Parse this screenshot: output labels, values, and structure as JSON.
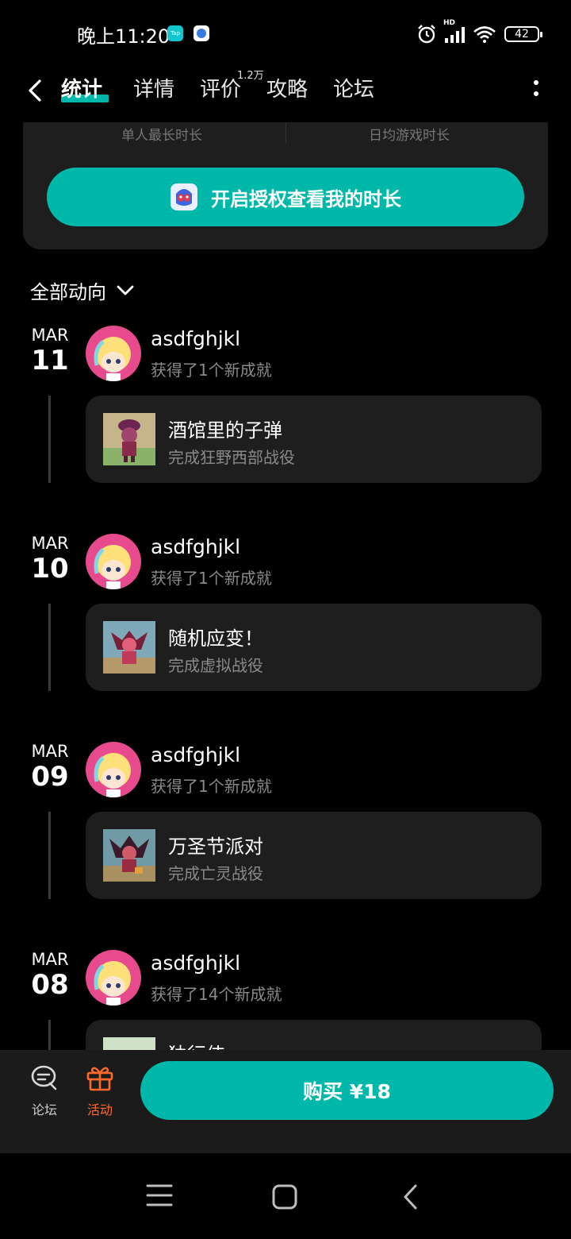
{
  "status": {
    "time": "晚上11:20",
    "tap_icon": "Tap",
    "hd": "HD",
    "battery": "42"
  },
  "nav": {
    "tabs": [
      "统计",
      "详情",
      "评价",
      "攻略",
      "论坛"
    ],
    "reviews_badge": "1.2万"
  },
  "stats_card": {
    "stat_left": "单人最长时长",
    "stat_right": "日均游戏时长",
    "auth_button": "开启授权查看我的时长"
  },
  "filter": {
    "label": "全部动向"
  },
  "feed": [
    {
      "month": "MAR",
      "day": "11",
      "user": "asdfghjkl",
      "action": "获得了1个新成就",
      "achievement": {
        "title": "酒馆里的子弹",
        "desc": "完成狂野西部战役"
      }
    },
    {
      "month": "MAR",
      "day": "10",
      "user": "asdfghjkl",
      "action": "获得了1个新成就",
      "achievement": {
        "title": "随机应变！",
        "desc": "完成虚拟战役"
      }
    },
    {
      "month": "MAR",
      "day": "09",
      "user": "asdfghjkl",
      "action": "获得了1个新成就",
      "achievement": {
        "title": "万圣节派对",
        "desc": "完成亡灵战役"
      }
    },
    {
      "month": "MAR",
      "day": "08",
      "user": "asdfghjkl",
      "action": "获得了14个新成就",
      "achievement": {
        "title": "独行侠",
        "desc": ""
      }
    }
  ],
  "bottom_bar": {
    "forum_label": "论坛",
    "activity_label": "活动",
    "buy_button": "购买 ¥18"
  },
  "icons": {
    "back": "chevron-left-icon",
    "more": "more-vertical-icon",
    "filter": "chevron-down-icon",
    "forum": "chat-bubble-icon",
    "activity": "gift-icon"
  },
  "colors": {
    "accent": "#00b8a9",
    "active_orange": "#ff6a2b",
    "background": "#000000",
    "card": "#1e1e1e"
  }
}
